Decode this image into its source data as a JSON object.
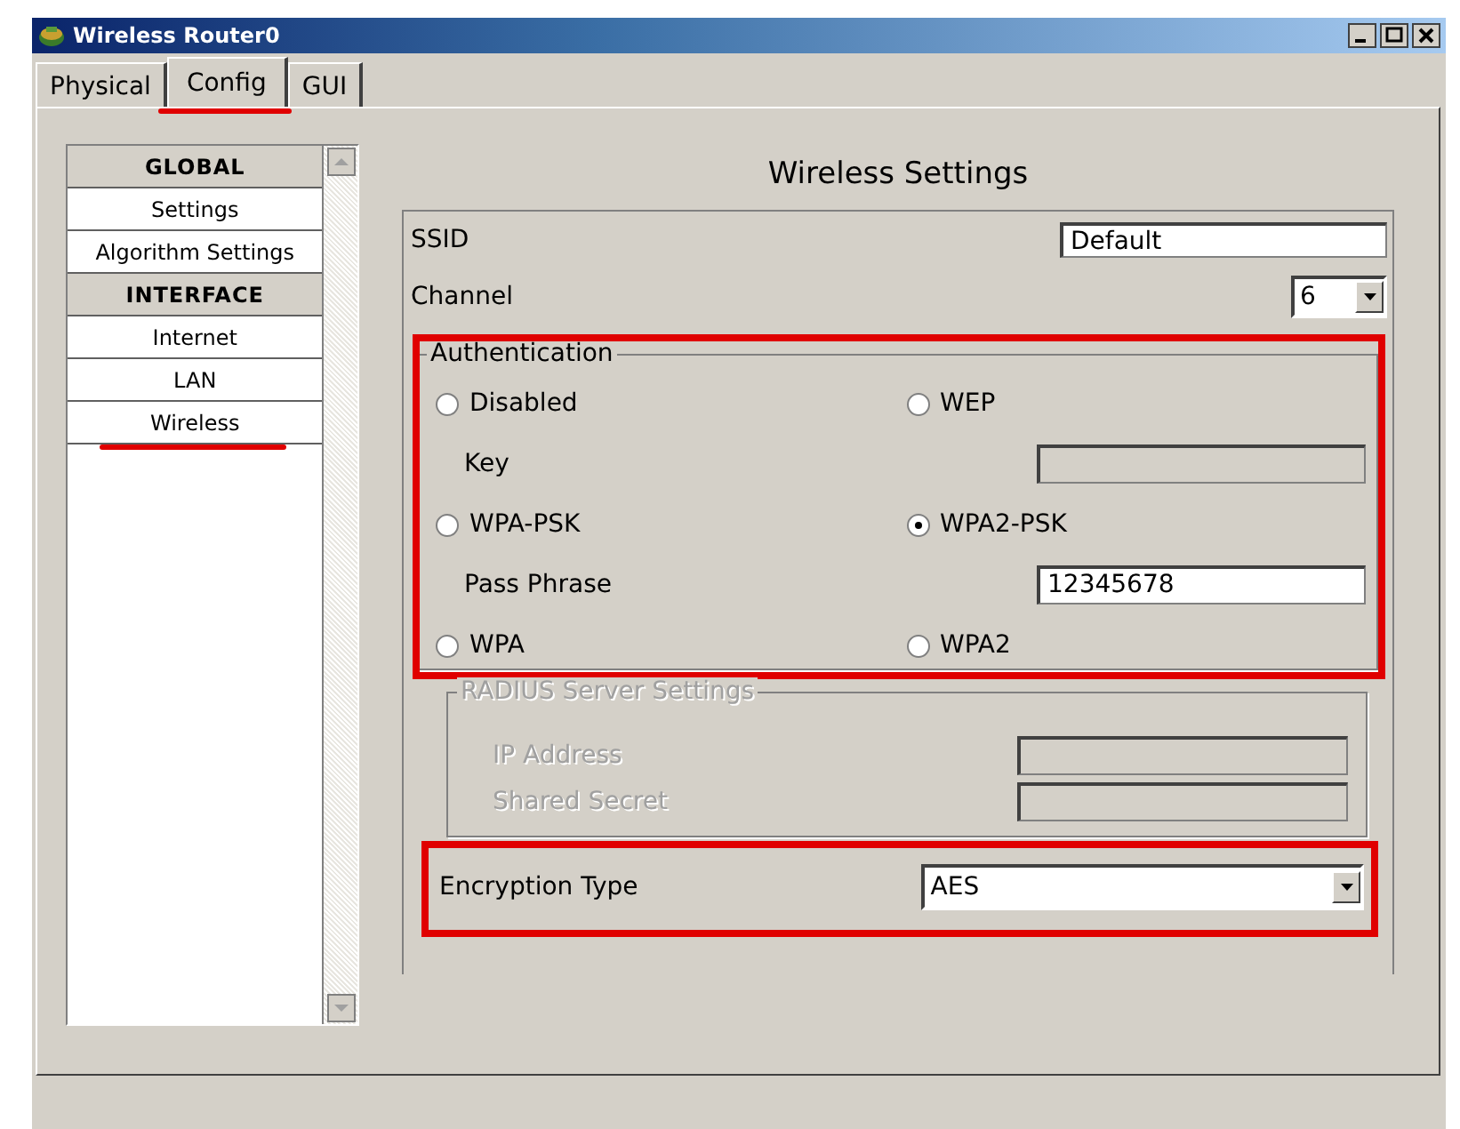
{
  "window": {
    "title": "Wireless Router0"
  },
  "tabs": [
    {
      "label": "Physical",
      "selected": false,
      "highlighted": false
    },
    {
      "label": "Config",
      "selected": true,
      "highlighted": true
    },
    {
      "label": "GUI",
      "selected": false,
      "highlighted": false
    }
  ],
  "sidebar": {
    "items": [
      {
        "kind": "header",
        "label": "GLOBAL"
      },
      {
        "kind": "item",
        "label": "Settings",
        "highlighted": false
      },
      {
        "kind": "item",
        "label": "Algorithm Settings",
        "highlighted": false
      },
      {
        "kind": "header",
        "label": "INTERFACE"
      },
      {
        "kind": "item",
        "label": "Internet",
        "highlighted": false
      },
      {
        "kind": "item",
        "label": "LAN",
        "highlighted": false
      },
      {
        "kind": "item",
        "label": "Wireless",
        "highlighted": true
      }
    ]
  },
  "panel": {
    "title": "Wireless Settings",
    "ssid": {
      "label": "SSID",
      "value": "Default"
    },
    "channel": {
      "label": "Channel",
      "value": "6"
    },
    "authentication": {
      "legend": "Authentication",
      "highlighted": true,
      "rows": [
        {
          "kind": "options",
          "options": [
            {
              "label": "Disabled",
              "selected": false
            },
            {
              "label": "WEP",
              "selected": false
            }
          ]
        },
        {
          "kind": "field",
          "label": "Key",
          "disabled": true
        },
        {
          "kind": "options",
          "options": [
            {
              "label": "WPA-PSK",
              "selected": false
            },
            {
              "label": "WPA2-PSK",
              "selected": true
            }
          ]
        },
        {
          "kind": "field",
          "label": "Pass Phrase",
          "value": "12345678",
          "disabled": false
        },
        {
          "kind": "options",
          "options": [
            {
              "label": "WPA",
              "selected": false
            },
            {
              "label": "WPA2",
              "selected": false
            }
          ]
        }
      ]
    },
    "radius": {
      "legend": "RADIUS Server Settings",
      "disabled": true,
      "fields": [
        {
          "label": "IP Address"
        },
        {
          "label": "Shared Secret"
        }
      ]
    },
    "encryption": {
      "label": "Encryption Type",
      "value": "AES",
      "highlighted": true
    }
  }
}
